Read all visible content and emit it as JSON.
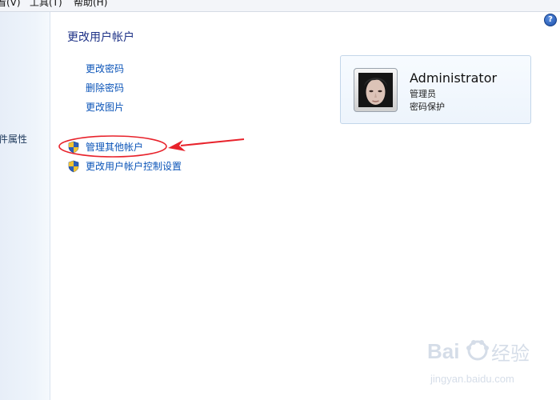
{
  "menubar": {
    "items": [
      {
        "label": "看(V)"
      },
      {
        "label": "工具(T)"
      },
      {
        "label": "帮助(H)"
      }
    ]
  },
  "left_nav": {
    "link_label": "件属性"
  },
  "help_icon": "help-icon",
  "main": {
    "title": "更改用户帐户",
    "tasks": [
      {
        "label": "更改密码"
      },
      {
        "label": "删除密码"
      },
      {
        "label": "更改图片"
      }
    ],
    "shield_tasks": [
      {
        "label": "管理其他帐户",
        "icon": "shield-icon"
      },
      {
        "label": "更改用户帐户控制设置",
        "icon": "shield-icon"
      }
    ]
  },
  "user_card": {
    "name": "Administrator",
    "role": "管理员",
    "status": "密码保护"
  },
  "annotation": {
    "color": "#e8222b"
  },
  "watermark": {
    "logo_text": "Baidu经验",
    "url": "jingyan.baidu.com"
  }
}
